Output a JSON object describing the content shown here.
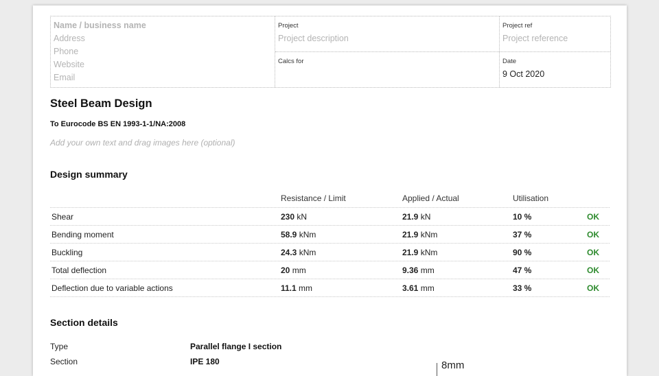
{
  "header": {
    "business": {
      "name_placeholder": "Name / business name",
      "address_placeholder": "Address",
      "phone_placeholder": "Phone",
      "website_placeholder": "Website",
      "email_placeholder": "Email"
    },
    "project_label": "Project",
    "project_placeholder": "Project description",
    "project_ref_label": "Project ref",
    "project_ref_placeholder": "Project reference",
    "calcs_for_label": "Calcs for",
    "calcs_for_value": "",
    "date_label": "Date",
    "date_value": "9 Oct 2020"
  },
  "document": {
    "title": "Steel Beam Design",
    "standard": "To Eurocode BS EN 1993-1-1/NA:2008",
    "notes_placeholder": "Add your own text and drag images here (optional)"
  },
  "design_summary": {
    "heading": "Design summary",
    "columns": [
      "Resistance / Limit",
      "Applied / Actual",
      "Utilisation"
    ],
    "rows": [
      {
        "name": "Shear",
        "resistance": "230",
        "resistance_unit": "kN",
        "applied": "21.9",
        "applied_unit": "kN",
        "utilisation": "10 %",
        "status": "OK"
      },
      {
        "name": "Bending moment",
        "resistance": "58.9",
        "resistance_unit": "kNm",
        "applied": "21.9",
        "applied_unit": "kNm",
        "utilisation": "37 %",
        "status": "OK"
      },
      {
        "name": "Buckling",
        "resistance": "24.3",
        "resistance_unit": "kNm",
        "applied": "21.9",
        "applied_unit": "kNm",
        "utilisation": "90 %",
        "status": "OK"
      },
      {
        "name": "Total deflection",
        "resistance": "20",
        "resistance_unit": "mm",
        "applied": "9.36",
        "applied_unit": "mm",
        "utilisation": "47 %",
        "status": "OK"
      },
      {
        "name": "Deflection due to variable actions",
        "resistance": "11.1",
        "resistance_unit": "mm",
        "applied": "3.61",
        "applied_unit": "mm",
        "utilisation": "33 %",
        "status": "OK"
      }
    ],
    "ok_color": "#2e8b2e"
  },
  "section_details": {
    "heading": "Section details",
    "type_label": "Type",
    "type_value": "Parallel flange I section",
    "section_label": "Section",
    "section_value": "IPE 180",
    "dimension_label": "8mm"
  }
}
